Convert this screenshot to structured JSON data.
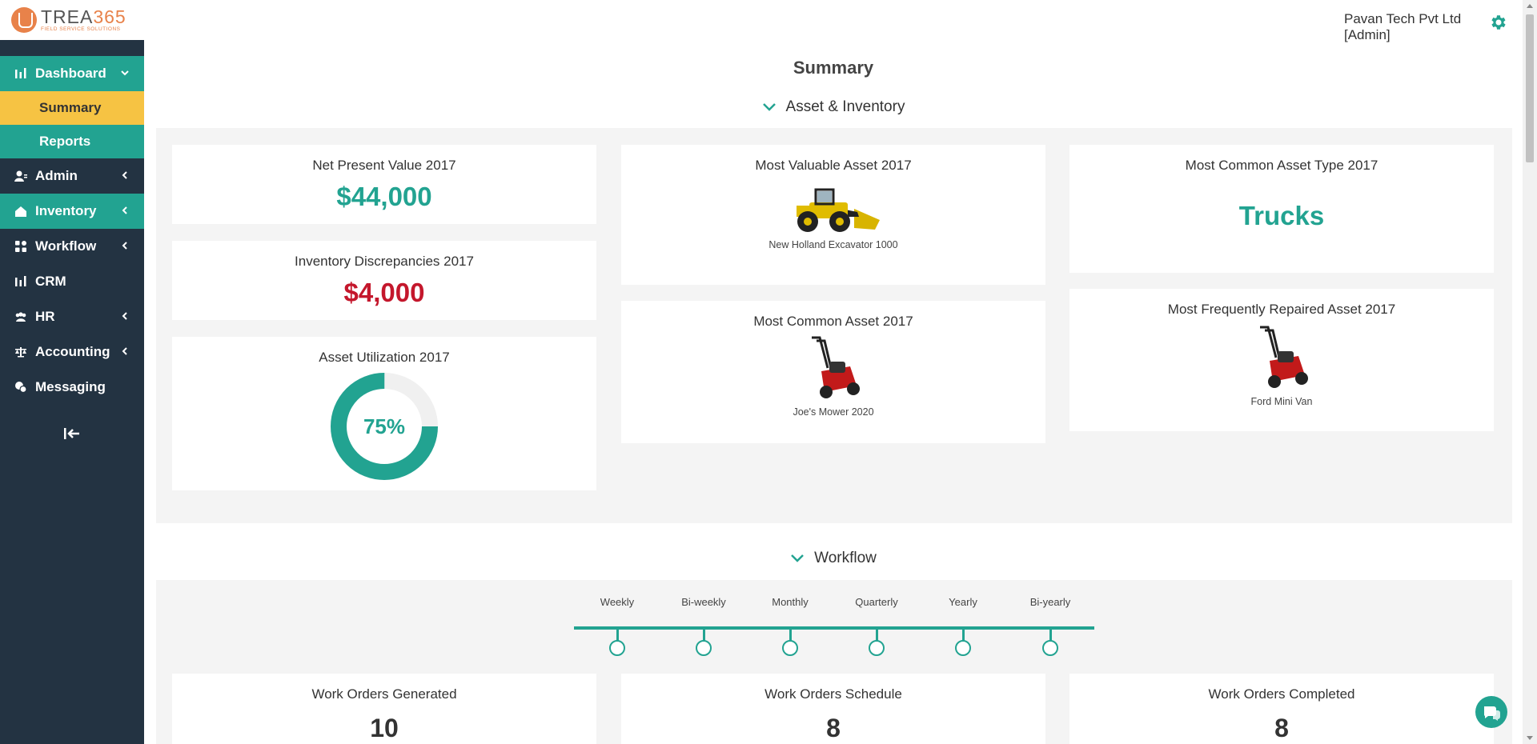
{
  "brand": {
    "name_prefix": "TREA",
    "name_suffix": "365",
    "tagline": "FIELD SERVICE SOLUTIONS"
  },
  "user": {
    "company": "Pavan Tech Pvt Ltd",
    "role": "[Admin]"
  },
  "sidebar": {
    "items": [
      {
        "label": "Dashboard",
        "icon": "bar-chart-icon"
      },
      {
        "label": "Summary"
      },
      {
        "label": "Reports"
      },
      {
        "label": "Admin",
        "icon": "user-icon"
      },
      {
        "label": "Inventory",
        "icon": "home-icon"
      },
      {
        "label": "Workflow",
        "icon": "grid-icon"
      },
      {
        "label": "CRM",
        "icon": "bar-chart-icon"
      },
      {
        "label": "HR",
        "icon": "people-icon"
      },
      {
        "label": "Accounting",
        "icon": "balance-icon"
      },
      {
        "label": "Messaging",
        "icon": "chat-icon"
      }
    ]
  },
  "page": {
    "title": "Summary"
  },
  "asset_section": {
    "title": "Asset & Inventory",
    "npv": {
      "title": "Net Present Value 2017",
      "value": "$44,000"
    },
    "discrepancies": {
      "title": "Inventory Discrepancies 2017",
      "value": "$4,000"
    },
    "utilization": {
      "title": "Asset Utilization 2017",
      "value": "75%",
      "fraction": 0.75
    },
    "most_valuable": {
      "title": "Most Valuable Asset 2017",
      "caption": "New Holland Excavator 1000"
    },
    "most_common": {
      "title": "Most Common Asset 2017",
      "caption": "Joe's Mower 2020"
    },
    "common_type": {
      "title": "Most Common Asset Type 2017",
      "value": "Trucks"
    },
    "most_repaired": {
      "title": "Most Frequently Repaired Asset 2017",
      "caption": "Ford Mini Van"
    }
  },
  "workflow_section": {
    "title": "Workflow",
    "periods": [
      "Weekly",
      "Bi-weekly",
      "Monthly",
      "Quarterly",
      "Yearly",
      "Bi-yearly"
    ],
    "generated": {
      "title": "Work Orders Generated",
      "value": "10"
    },
    "schedule": {
      "title": "Work Orders Schedule",
      "value": "8"
    },
    "completed": {
      "title": "Work Orders Completed",
      "value": "8"
    }
  },
  "colors": {
    "sidebar": "#233342",
    "accent": "#22a391",
    "highlight": "#f6c343",
    "alert": "#c4172c",
    "brand": "#e8824a"
  }
}
